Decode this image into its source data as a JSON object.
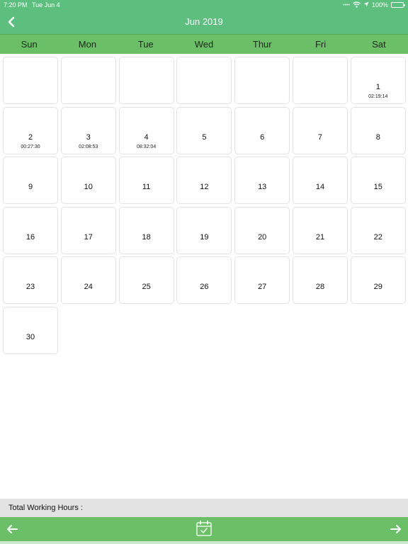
{
  "status_bar": {
    "time": "7:20 PM",
    "date": "Tue Jun 4",
    "battery": "100%"
  },
  "nav": {
    "title": "Jun 2019",
    "back_icon": "chevron-left-icon"
  },
  "weekdays": [
    "Sun",
    "Mon",
    "Tue",
    "Wed",
    "Thur",
    "Fri",
    "Sat"
  ],
  "calendar": {
    "leading_blanks": 6,
    "days": [
      {
        "day": "1",
        "hours": "02:19:14"
      },
      {
        "day": "2",
        "hours": "00:27:30"
      },
      {
        "day": "3",
        "hours": "02:08:53"
      },
      {
        "day": "4",
        "hours": "08:32:04"
      },
      {
        "day": "5",
        "hours": ""
      },
      {
        "day": "6",
        "hours": ""
      },
      {
        "day": "7",
        "hours": ""
      },
      {
        "day": "8",
        "hours": ""
      },
      {
        "day": "9",
        "hours": ""
      },
      {
        "day": "10",
        "hours": ""
      },
      {
        "day": "11",
        "hours": ""
      },
      {
        "day": "12",
        "hours": ""
      },
      {
        "day": "13",
        "hours": ""
      },
      {
        "day": "14",
        "hours": ""
      },
      {
        "day": "15",
        "hours": ""
      },
      {
        "day": "16",
        "hours": ""
      },
      {
        "day": "17",
        "hours": ""
      },
      {
        "day": "18",
        "hours": ""
      },
      {
        "day": "19",
        "hours": ""
      },
      {
        "day": "20",
        "hours": ""
      },
      {
        "day": "21",
        "hours": ""
      },
      {
        "day": "22",
        "hours": ""
      },
      {
        "day": "23",
        "hours": ""
      },
      {
        "day": "24",
        "hours": ""
      },
      {
        "day": "25",
        "hours": ""
      },
      {
        "day": "26",
        "hours": ""
      },
      {
        "day": "27",
        "hours": ""
      },
      {
        "day": "28",
        "hours": ""
      },
      {
        "day": "29",
        "hours": ""
      },
      {
        "day": "30",
        "hours": ""
      }
    ]
  },
  "footer": {
    "total_label": "Total Working Hours :",
    "prev_icon": "arrow-left-icon",
    "calendar_icon": "calendar-check-icon",
    "next_icon": "arrow-right-icon"
  },
  "colors": {
    "header": "#5dbf7e",
    "weekday_bar": "#6bbf67",
    "total_bar": "#e3e3e3"
  }
}
